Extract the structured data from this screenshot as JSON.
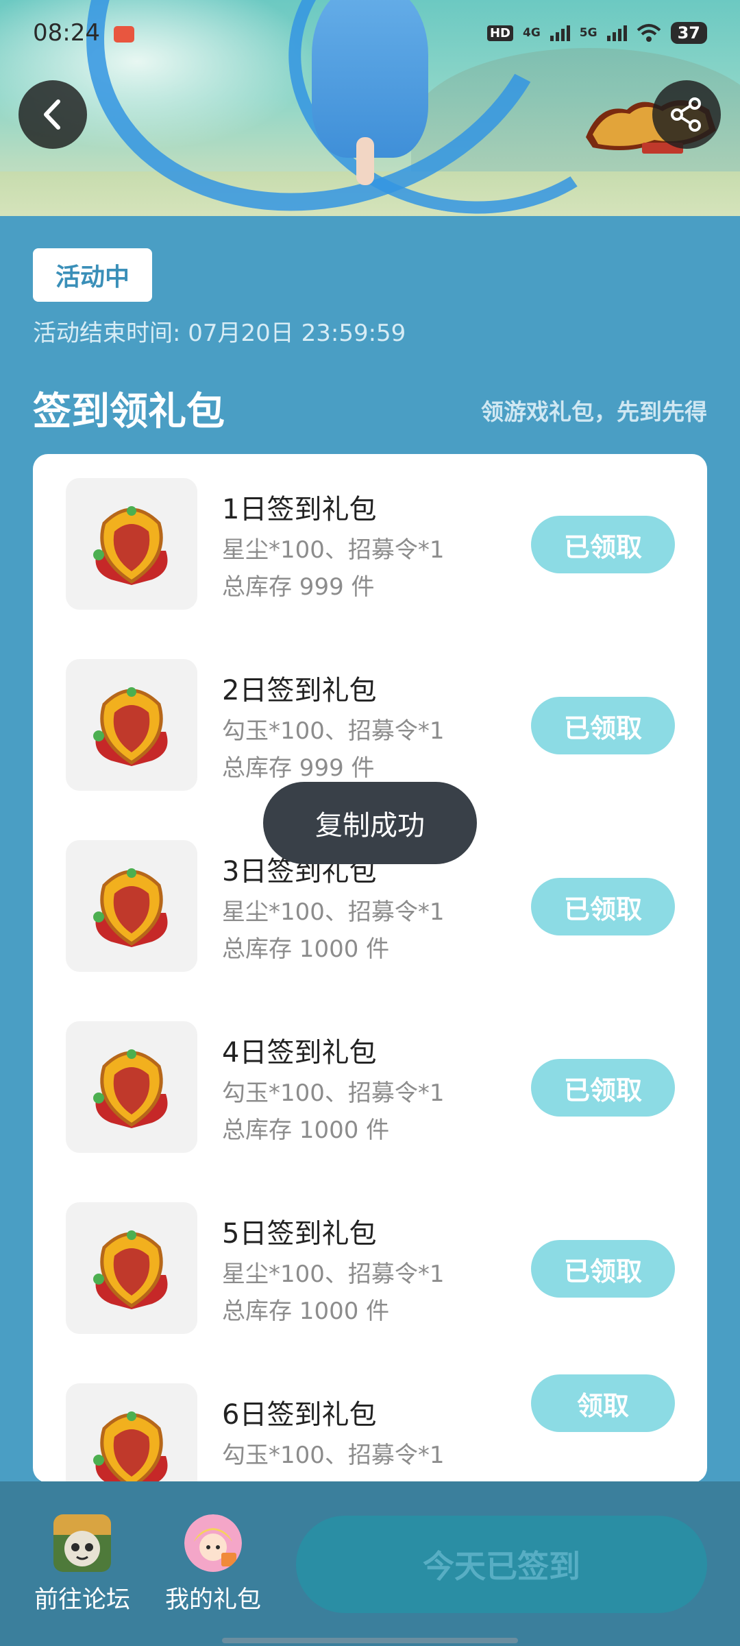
{
  "status_bar": {
    "time": "08:24",
    "hd": "HD",
    "net1": "4G",
    "net2": "5G",
    "battery": "37"
  },
  "header": {
    "back_icon": "chevron-left-icon",
    "share_icon": "share-icon"
  },
  "activity": {
    "status_tag": "活动中",
    "end_time": "活动结束时间: 07月20日 23:59:59"
  },
  "section": {
    "title": "签到领礼包",
    "subtitle": "领游戏礼包，先到先得"
  },
  "gifts": [
    {
      "title": "1日签到礼包",
      "desc": "星尘*100、招募令*1",
      "stock": "总库存 999 件",
      "button": "已领取"
    },
    {
      "title": "2日签到礼包",
      "desc": "勾玉*100、招募令*1",
      "stock": "总库存 999 件",
      "button": "已领取"
    },
    {
      "title": "3日签到礼包",
      "desc": "星尘*100、招募令*1",
      "stock": "总库存 1000 件",
      "button": "已领取"
    },
    {
      "title": "4日签到礼包",
      "desc": "勾玉*100、招募令*1",
      "stock": "总库存 1000 件",
      "button": "已领取"
    },
    {
      "title": "5日签到礼包",
      "desc": "星尘*100、招募令*1",
      "stock": "总库存 1000 件",
      "button": "已领取"
    },
    {
      "title": "6日签到礼包",
      "desc": "勾玉*100、招募令*1",
      "stock": "",
      "button": "领取"
    }
  ],
  "toast": "复制成功",
  "bottom_bar": {
    "forum_label": "前往论坛",
    "mygifts_label": "我的礼包",
    "sign_button": "今天已签到"
  },
  "colors": {
    "page_bg": "#4a9ec4",
    "button_bg": "#8cdbe4",
    "bottom_bg": "#3b7f9c",
    "sign_btn_bg": "#2a8ea4"
  }
}
